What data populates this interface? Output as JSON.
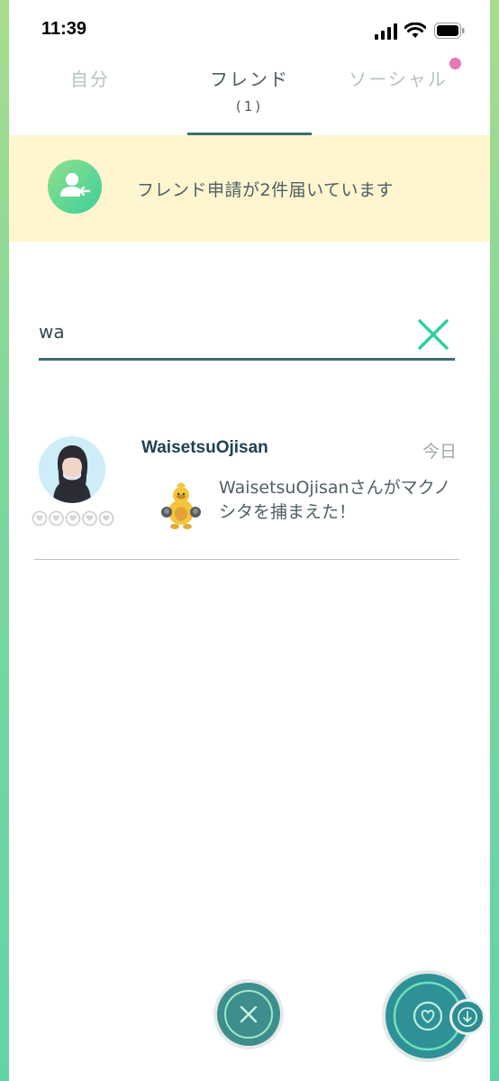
{
  "status_bar": {
    "time": "11:39"
  },
  "tabs": [
    {
      "label": "自分"
    },
    {
      "label": "フレンド",
      "count": "(1)"
    },
    {
      "label": "ソーシャル"
    }
  ],
  "banner": {
    "text": "フレンド申請が2件届いています",
    "icon": "add-friend-icon"
  },
  "search": {
    "value": "wa",
    "placeholder": ""
  },
  "friends": [
    {
      "name": "WaisetsuOjisan",
      "date": "今日",
      "activity": "WaisetsuOjisanさんがマクノシタを捕まえた！",
      "hearts_filled": 0,
      "hearts_total": 5
    }
  ],
  "colors": {
    "accent": "#3f6e72",
    "banner_bg": "#fff5cf",
    "clear_icon": "#2ecf9e",
    "notify_dot": "#e478b8",
    "action_button": "#2f9097"
  }
}
